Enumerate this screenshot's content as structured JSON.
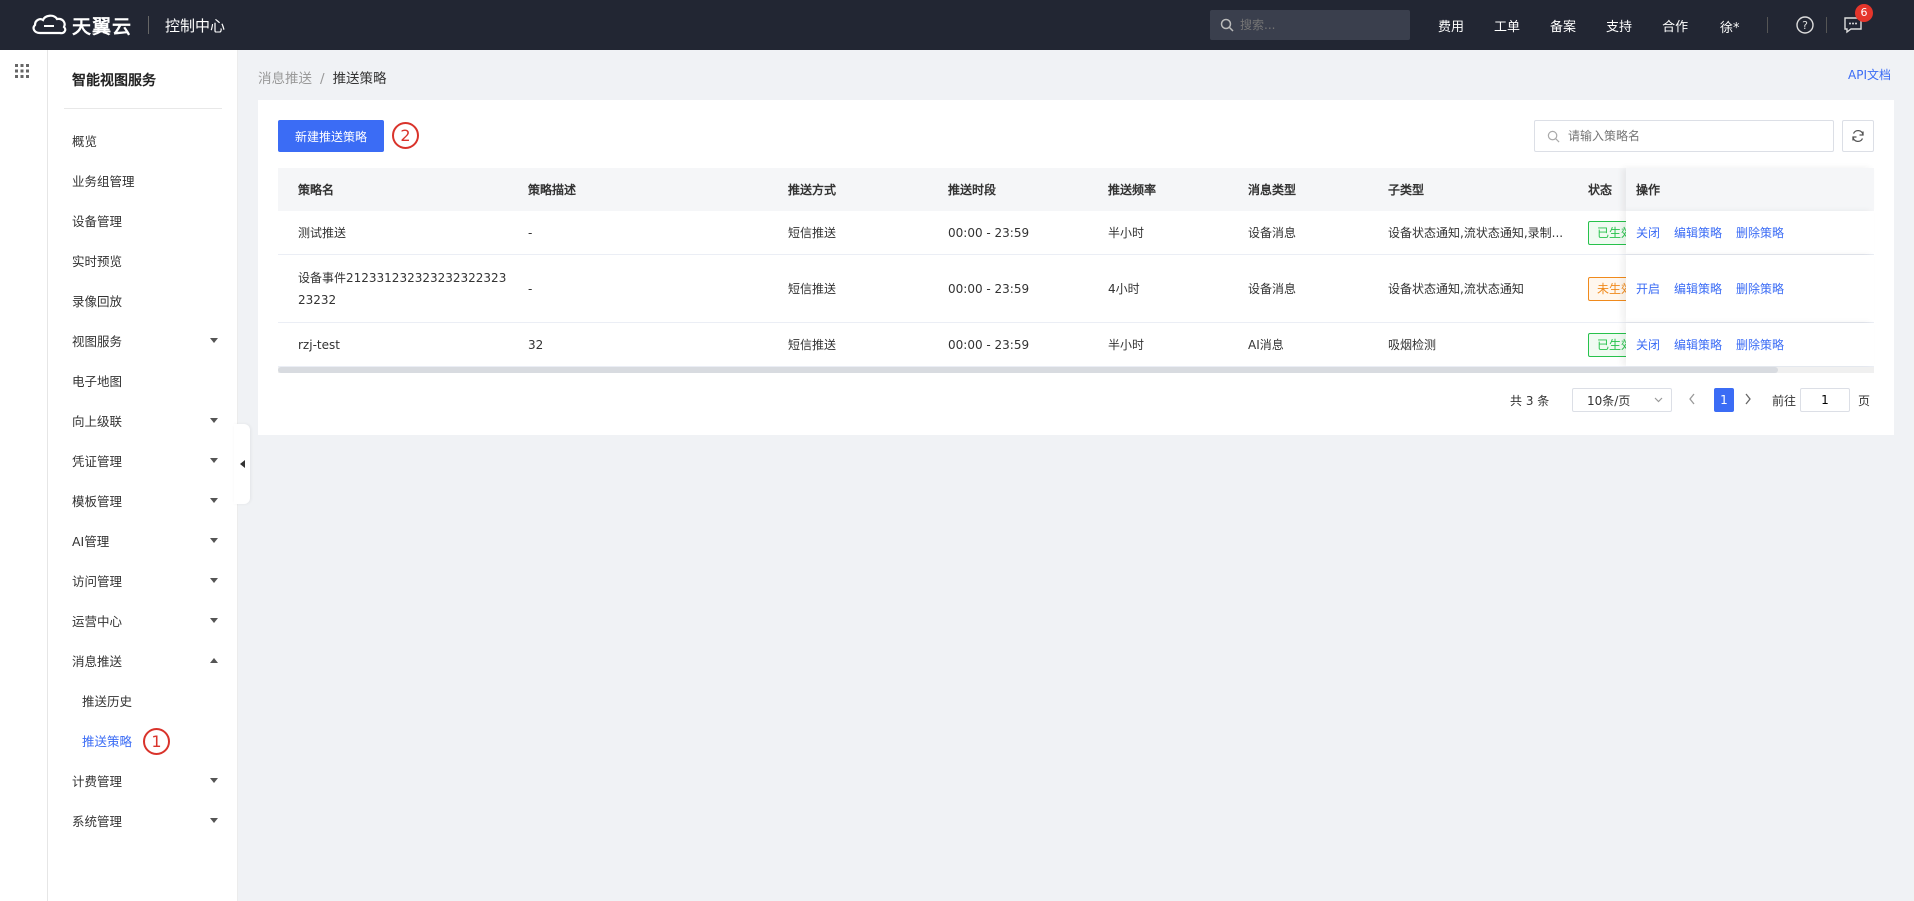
{
  "topbar": {
    "logo_text": "天翼云",
    "console": "控制中心",
    "search_placeholder": "搜索...",
    "nav": [
      "费用",
      "工单",
      "备案",
      "支持",
      "合作"
    ],
    "user": "徐*",
    "msg_count": "6"
  },
  "sidebar": {
    "title": "智能视图服务",
    "items": [
      {
        "label": "概览",
        "caret": ""
      },
      {
        "label": "业务组管理",
        "caret": ""
      },
      {
        "label": "设备管理",
        "caret": ""
      },
      {
        "label": "实时预览",
        "caret": ""
      },
      {
        "label": "录像回放",
        "caret": ""
      },
      {
        "label": "视图服务",
        "caret": "down"
      },
      {
        "label": "电子地图",
        "caret": ""
      },
      {
        "label": "向上级联",
        "caret": "down"
      },
      {
        "label": "凭证管理",
        "caret": "down"
      },
      {
        "label": "模板管理",
        "caret": "down"
      },
      {
        "label": "AI管理",
        "caret": "down"
      },
      {
        "label": "访问管理",
        "caret": "down"
      },
      {
        "label": "运营中心",
        "caret": "down"
      },
      {
        "label": "消息推送",
        "caret": "up"
      },
      {
        "label": "推送历史",
        "caret": "",
        "sub": true
      },
      {
        "label": "推送策略",
        "caret": "",
        "sub": true,
        "active": true
      },
      {
        "label": "计费管理",
        "caret": "down"
      },
      {
        "label": "系统管理",
        "caret": "down"
      }
    ]
  },
  "annotations": [
    "1",
    "2"
  ],
  "breadcrumb": {
    "parent": "消息推送",
    "sep": "/",
    "current": "推送策略"
  },
  "api_doc": "API文档",
  "toolbar": {
    "new_button": "新建推送策略",
    "search_placeholder": "请输入策略名"
  },
  "table": {
    "headers": [
      "策略名",
      "策略描述",
      "推送方式",
      "推送时段",
      "推送频率",
      "消息类型",
      "子类型",
      "状态",
      "操作"
    ],
    "rows": [
      {
        "name": "测试推送",
        "desc": "-",
        "method": "短信推送",
        "period": "00:00 - 23:59",
        "freq": "半小时",
        "msg_type": "设备消息",
        "sub_type": "设备状态通知,流状态通知,录制...",
        "status": "已生效",
        "status_color": "#27c24c",
        "ops": [
          "关闭",
          "编辑策略",
          "删除策略"
        ]
      },
      {
        "name": "设备事件21233123232323232232323232",
        "desc": "-",
        "method": "短信推送",
        "period": "00:00 - 23:59",
        "freq": "4小时",
        "msg_type": "设备消息",
        "sub_type": "设备状态通知,流状态通知",
        "status": "未生效",
        "status_color": "#f08a1c",
        "ops": [
          "开启",
          "编辑策略",
          "删除策略"
        ]
      },
      {
        "name": "rzj-test",
        "desc": "32",
        "method": "短信推送",
        "period": "00:00 - 23:59",
        "freq": "半小时",
        "msg_type": "AI消息",
        "sub_type": "吸烟检测",
        "status": "已生效",
        "status_color": "#27c24c",
        "ops": [
          "关闭",
          "编辑策略",
          "删除策略"
        ]
      }
    ]
  },
  "pagination": {
    "total": "共 3 条",
    "page_size": "10条/页",
    "current_page": "1",
    "goto_label": "前往",
    "goto_value": "1",
    "page_unit": "页"
  }
}
